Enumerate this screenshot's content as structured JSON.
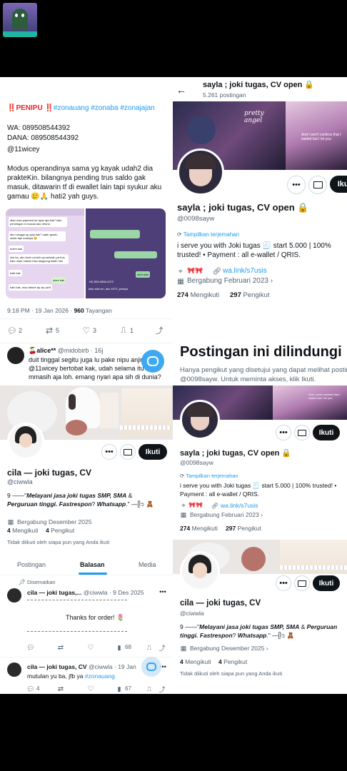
{
  "left_post": {
    "header_prefix": "‼️PENIPU ‼️",
    "hashtags": "#zonauang #zonaba #zonajajan",
    "wa": "WA: 089508544392",
    "dana": "DANA: 089508544392",
    "handle": "@11wicey",
    "body": "Modus operandinya sama yg kayak udah2 dia prakteKin. bilangnya pending trus saldo gak masuk, ditawarin tf di ewallet lain tapi syukur aku gamau 🥲🙏 hati2 yah guys.",
    "time": "9:18 PM · 19 Jan 2026 · ",
    "views_count": "960",
    "views_label": " Tayangan",
    "replies": "2",
    "reposts": "5",
    "likes": "3",
    "bookmarks": "1",
    "chat_lines": [
      "atau mau payment ke ayaz aja kak? kalo pendingan ni masuk aku refund",
      "aku nunggu sp gopi kak? udah gesdo selde tapi soalnya 😊",
      "boleh kak",
      "oke ka, aku kirim contoh qa sekolah ya trus kalo udah masuk bisa langsung kasih oke",
      "balk kak",
      "okee kak",
      "kalo kak, mau failure ap.vip pwd",
      "ulmi cbia",
      "+62 895-0856-4372",
      "kalo ada sm, aku 4072, jadinya"
    ]
  },
  "left_reply": {
    "name": "🍒alice**",
    "handle": "@midobirb",
    "time": "· 16j",
    "text": "duit tinggal segitu juga lu pake nipu anjir @11wicey bertobat kak, udah selama itu mmasih aja loh. emang nyari apa sih di dunia?"
  },
  "cila": {
    "name": "cila — joki tugas, CV",
    "handle": "@ciwwla",
    "bio_prefix": "9 ——\"",
    "bio_italic_1": "Melayani jasa joki tugas SMP, SMA",
    "bio_mid": " & ",
    "bio_italic_2": "Perguruan tinggi. Fastrespon",
    "bio_mid2": "? ",
    "bio_italic_3": "Whatsapp",
    "bio_suffix": ".\" —ᥫ᭡ 🧸",
    "joined": "Bergabung Desember 2025",
    "following_count": "4",
    "following_label": "Mengikuti",
    "followers_count": "4",
    "followers_label": "Pengikut",
    "not_followed": "Tidak diikuti oleh siapa pun yang Anda ikuti",
    "follow_label": "Ikuti",
    "tabs": [
      "Postingan",
      "Balasan",
      "Media"
    ],
    "pinned_label": "Disematkan",
    "pinned_name": "cila — joki tugas,...",
    "pinned_handle": "@ciwwla",
    "pinned_date": "· 9 Des 2025",
    "pinned_text": "Thanks for order! 🌷",
    "pinned_views": "68",
    "post2_name": "cila — joki tugas, CV",
    "post2_handle": "@ciwwla · 19 Jan",
    "post2_text": "mutulan yu ba, jfb ya ",
    "post2_tag": "#zonauang",
    "post2_replies": "4",
    "post2_views": "67"
  },
  "sayla": {
    "header_name": "sayla ; joki tugas, CV open 🔒",
    "post_count": "5.261 postingan",
    "name": "sayla ; joki tugas, CV open 🔒",
    "handle": "@0098sayw",
    "translate": "Tampilkan terjemahan",
    "bio": "i serve you with Joki tugas 🧾 start 5.000 | 100% trusted! • Payment : all e-wallet / QRIS.",
    "link": "wa.link/s7usis",
    "joined": "Bergabung Februari 2023",
    "following_count": "274",
    "following_label": "Mengikuti",
    "followers_count": "297",
    "followers_label": "Pengikut",
    "follow_label": "Ikuti",
    "banner_text_1": "pretty angel",
    "banner_text_2": "And I won't confess that I waited but I let you"
  },
  "protected": {
    "title": "Postingan ini dilindungi",
    "desc": "Hanya pengikut yang disetujui yang dapat melihat postingan @0098sayw. Untuk meminta akses, klik Ikuti."
  },
  "colors": {
    "accent": "#1d9bf0",
    "muted": "#536471",
    "text": "#0f1419",
    "alert": "#f4212e"
  }
}
